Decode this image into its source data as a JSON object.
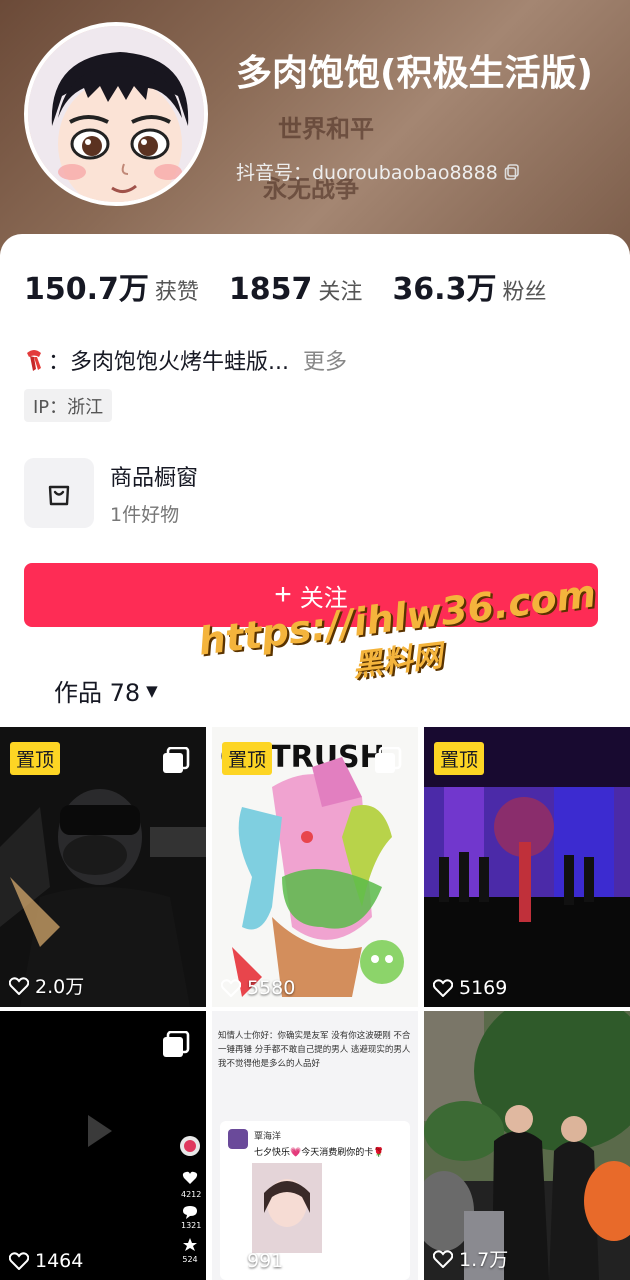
{
  "profile": {
    "nickname": "多肉饱饱(积极生活版)",
    "douyin_id": "抖音号：duoroubaobao8888",
    "header_bg_text_1": "世界和平",
    "header_bg_text_2": "永无战争"
  },
  "stats": [
    {
      "value": "150.7万",
      "label": "获赞"
    },
    {
      "value": "1857",
      "label": "关注"
    },
    {
      "value": "36.3万",
      "label": "粉丝"
    }
  ],
  "bio": {
    "text": "：多肉饱饱火烤牛蛙版...",
    "more": "更多",
    "icon": "scarf-emoji"
  },
  "ip": "IP：浙江",
  "shop": {
    "title": "商品橱窗",
    "subtitle": "1件好物",
    "icon": "shopping-bag-icon"
  },
  "follow_button": {
    "label": "关注",
    "icon": "plus-icon"
  },
  "works_tab": {
    "label": "作品 78",
    "icon": "caret-down-icon"
  },
  "watermark": {
    "url": "https://ihlw36.com",
    "sub": "黑料网"
  },
  "grid": [
    {
      "pinned": true,
      "pin_label": "置顶",
      "multi": true,
      "likes": "2.0万"
    },
    {
      "pinned": true,
      "pin_label": "置顶",
      "multi": true,
      "likes": "5580"
    },
    {
      "pinned": true,
      "pin_label": "置顶",
      "multi": false,
      "likes": "5169"
    },
    {
      "pinned": false,
      "pin_label": "",
      "multi": true,
      "likes": "1464"
    },
    {
      "pinned": false,
      "pin_label": "",
      "multi": false,
      "likes": "991"
    },
    {
      "pinned": false,
      "pin_label": "",
      "multi": false,
      "likes": "1.7万"
    }
  ],
  "tile5": {
    "post_text": "知情人士你好：你确实是友军 没有你这波硬刚 不合一锤再锤 分手都不敢自己提的男人 逃避现实的男人我不觉得他是多么的人品好",
    "greeting_name": "覃海洋",
    "greeting_text": "七夕快乐💗今天消费刷你的卡🌹"
  },
  "tile4_side": {
    "like_count": "4212",
    "comment_count": "1321",
    "fav_count": "524"
  },
  "colors": {
    "accent": "#fe2c55",
    "pin": "#fdd524",
    "watermark": "#f4b43c"
  }
}
